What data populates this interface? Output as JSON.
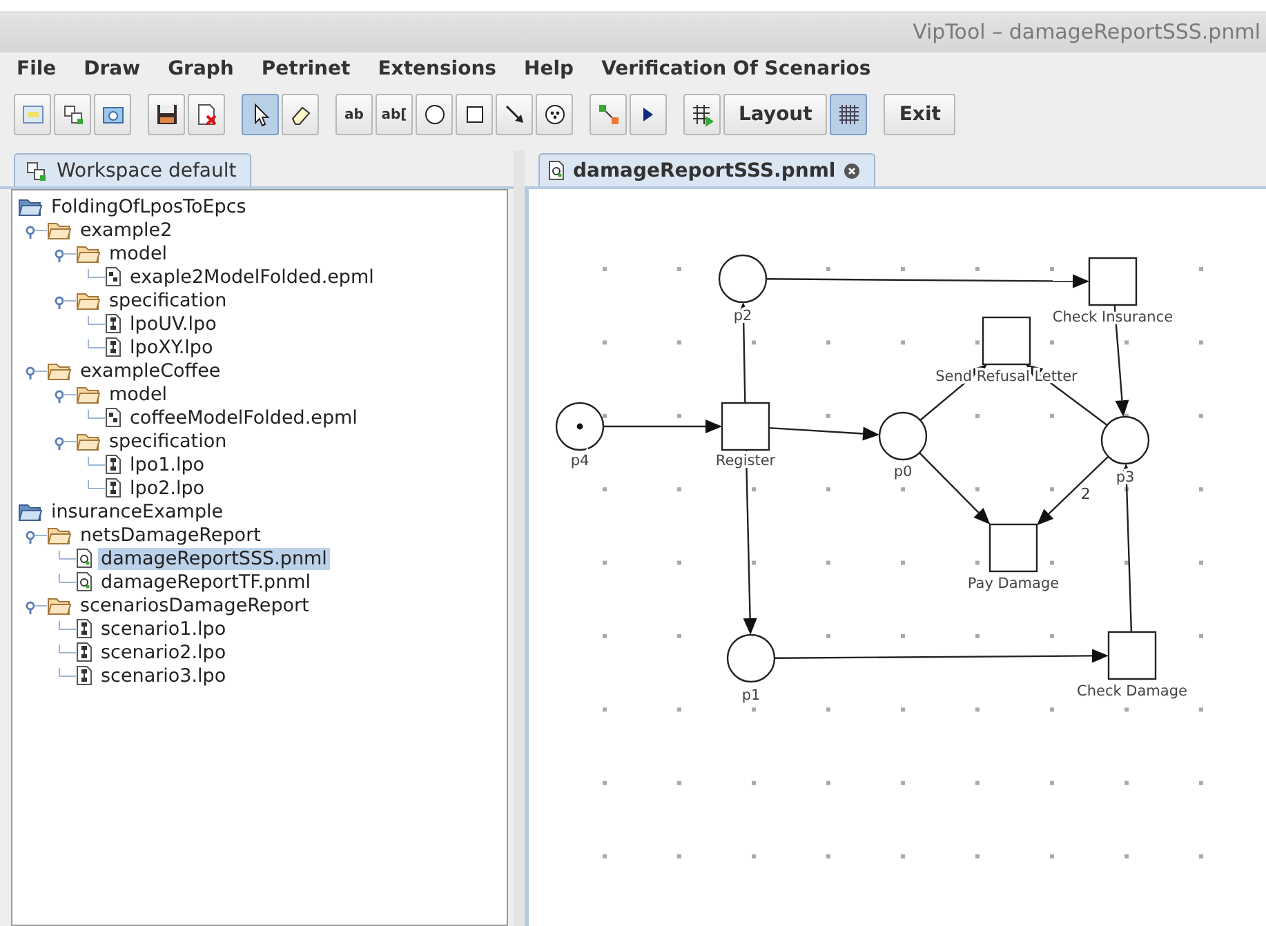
{
  "window": {
    "title": "VipTool – damageReportSSS.pnml"
  },
  "menu": [
    "File",
    "Draw",
    "Graph",
    "Petrinet",
    "Extensions",
    "Help",
    "Verification Of Scenarios"
  ],
  "toolbar": [
    [
      {
        "kind": "window",
        "selected": false
      },
      {
        "kind": "workspace",
        "selected": false
      },
      {
        "kind": "photo",
        "selected": false
      }
    ],
    [
      {
        "kind": "save",
        "selected": false
      },
      {
        "kind": "delete",
        "selected": false
      }
    ],
    [
      {
        "kind": "pointer",
        "selected": true
      },
      {
        "kind": "eraser",
        "selected": false
      }
    ],
    [
      {
        "kind": "label",
        "label": "ab",
        "selected": false
      },
      {
        "kind": "label",
        "label": "ab[",
        "selected": false
      },
      {
        "kind": "place",
        "selected": false
      },
      {
        "kind": "transition",
        "selected": false
      },
      {
        "kind": "arc",
        "selected": false
      },
      {
        "kind": "token",
        "selected": false
      }
    ],
    [
      {
        "kind": "net",
        "selected": false
      },
      {
        "kind": "play",
        "selected": false
      }
    ],
    [
      {
        "kind": "runner",
        "selected": false
      },
      {
        "kind": "text",
        "label": "Layout",
        "selected": false
      },
      {
        "kind": "grid",
        "selected": true
      }
    ],
    [
      {
        "kind": "text",
        "label": "Exit",
        "selected": false
      }
    ]
  ],
  "workspace_tab": {
    "label": "Workspace default",
    "selected": true
  },
  "tree": [
    {
      "label": "FoldingOfLposToEpcs",
      "kind": "root",
      "expanded": true,
      "selected": false,
      "children": [
        {
          "label": "example2",
          "kind": "folder",
          "expanded": true,
          "selected": false,
          "children": [
            {
              "label": "model",
              "kind": "folder",
              "expanded": true,
              "selected": false,
              "children": [
                {
                  "label": "exaple2ModelFolded.epml",
                  "kind": "epml",
                  "selected": false
                }
              ]
            },
            {
              "label": "specification",
              "kind": "folder",
              "expanded": true,
              "selected": false,
              "children": [
                {
                  "label": "lpoUV.lpo",
                  "kind": "lpo",
                  "selected": false
                },
                {
                  "label": "lpoXY.lpo",
                  "kind": "lpo",
                  "selected": false
                }
              ]
            }
          ]
        },
        {
          "label": "exampleCoffee",
          "kind": "folder",
          "expanded": true,
          "selected": false,
          "children": [
            {
              "label": "model",
              "kind": "folder",
              "expanded": true,
              "selected": false,
              "children": [
                {
                  "label": "coffeeModelFolded.epml",
                  "kind": "epml",
                  "selected": false
                }
              ]
            },
            {
              "label": "specification",
              "kind": "folder",
              "expanded": true,
              "selected": false,
              "children": [
                {
                  "label": "lpo1.lpo",
                  "kind": "lpo",
                  "selected": false
                },
                {
                  "label": "lpo2.lpo",
                  "kind": "lpo",
                  "selected": false
                }
              ]
            }
          ]
        }
      ]
    },
    {
      "label": "insuranceExample",
      "kind": "root",
      "expanded": true,
      "selected": false,
      "children": [
        {
          "label": "netsDamageReport",
          "kind": "folder",
          "expanded": true,
          "selected": false,
          "children": [
            {
              "label": "damageReportSSS.pnml",
              "kind": "pnml",
              "selected": true
            },
            {
              "label": "damageReportTF.pnml",
              "kind": "pnml",
              "selected": false
            }
          ]
        },
        {
          "label": "scenariosDamageReport",
          "kind": "folder",
          "expanded": true,
          "selected": false,
          "children": [
            {
              "label": "scenario1.lpo",
              "kind": "lpo",
              "selected": false
            },
            {
              "label": "scenario2.lpo",
              "kind": "lpo",
              "selected": false
            },
            {
              "label": "scenario3.lpo",
              "kind": "lpo",
              "selected": false
            }
          ]
        }
      ]
    }
  ],
  "editor_tab": {
    "label": "damageReportSSS.pnml",
    "selected": true
  },
  "net": {
    "nodes": [
      {
        "kind": "place",
        "label": "p2",
        "marked": false
      },
      {
        "kind": "transition",
        "label": "Check Insurance"
      },
      {
        "kind": "transition",
        "label": "Send Refusal Letter"
      },
      {
        "kind": "place",
        "label": "p4",
        "marked": true
      },
      {
        "kind": "transition",
        "label": "Register"
      },
      {
        "kind": "place",
        "label": "p0",
        "marked": false
      },
      {
        "kind": "place",
        "label": "p3",
        "marked": false
      },
      {
        "kind": "transition",
        "label": "Pay Damage"
      },
      {
        "kind": "place",
        "label": "p1",
        "marked": false
      },
      {
        "kind": "transition",
        "label": "Check Damage"
      }
    ],
    "arc_weights": [
      "2"
    ]
  }
}
